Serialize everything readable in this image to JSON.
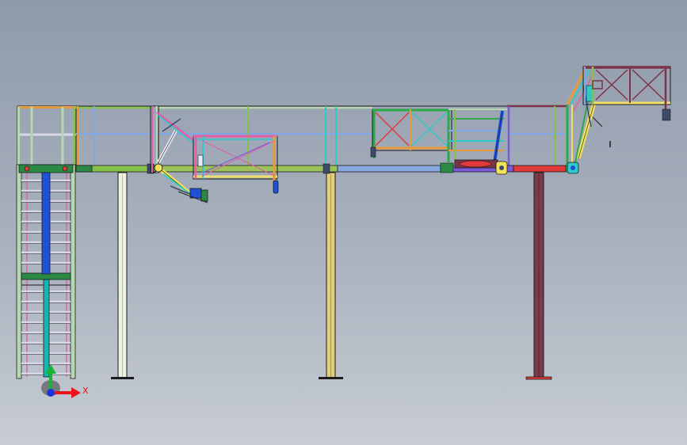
{
  "viewport": {
    "background_top": "#8e9aab",
    "background_bottom": "#c7ccd4"
  },
  "triad": {
    "x_label": "X",
    "x_color": "#e8161b",
    "y_color": "#16b23a",
    "origin_color": "#1d33e0"
  },
  "colors": {
    "outline": "#1c1c1c",
    "stair_stringer": "#b7d7b0",
    "stair_rung": "#d8d8e8",
    "stair_center": "#1e50d8",
    "stair_center_alt": "#18b6b2",
    "landing": "#2a8a44",
    "deck_left": "#86c24b",
    "deck_mid": "#8aa8e0",
    "deck_right": "#e13a3a",
    "deck_purple": "#7a5bd8",
    "rail_orange": "#e79a3a",
    "rail_blue": "#7fa8e6",
    "rail_green": "#2ea84a",
    "rail_cyan": "#2fc9c9",
    "rail_pink": "#e05fa8",
    "rail_yellow": "#f0e06a",
    "rail_maroon": "#7d3346",
    "column_1": "#eef2e2",
    "column_2": "#e1cf7d",
    "column_3": "#7a3b4a",
    "mechanism": "#f3e35a",
    "mechanism_dark": "#3d4a6a"
  },
  "parts": [
    "stair",
    "walkway",
    "left-gangway-arm",
    "center-cage",
    "right-frame",
    "right-gangway-arm",
    "upper-platform",
    "support-columns"
  ]
}
